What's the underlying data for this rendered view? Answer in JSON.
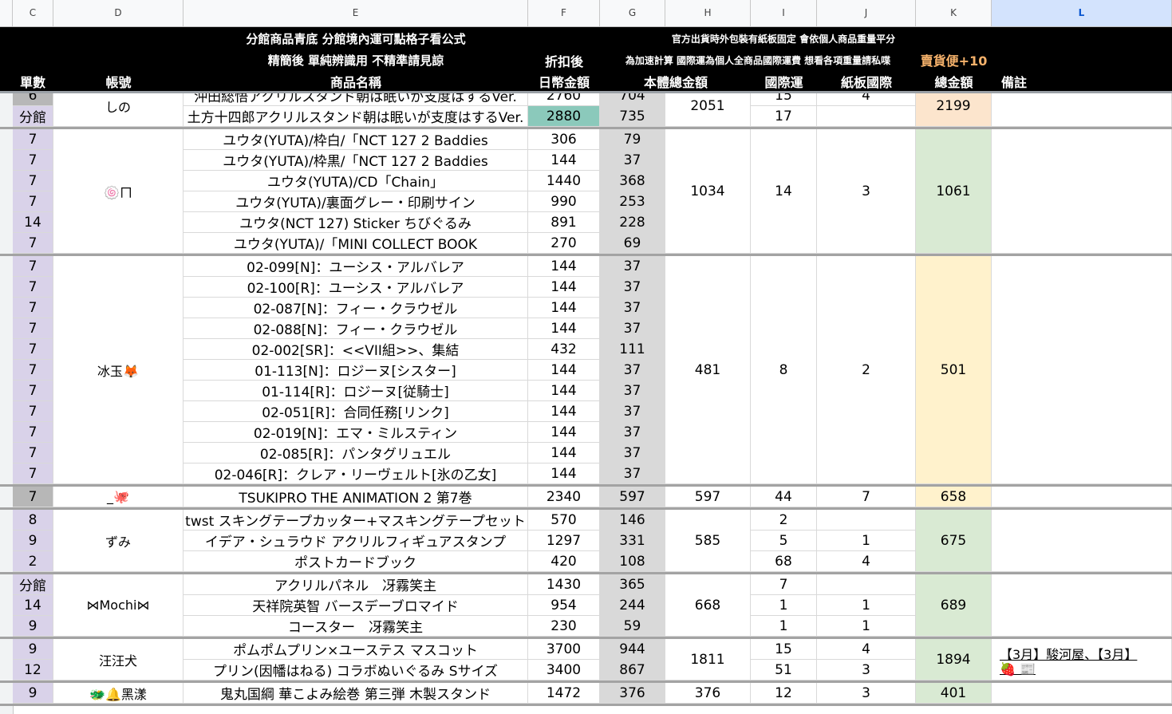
{
  "columns": [
    "C",
    "D",
    "E",
    "F",
    "G",
    "H",
    "I",
    "J",
    "K",
    "L"
  ],
  "selected_column": "L",
  "header": {
    "row1": {
      "E": "分館商品青底 分館境內運可點格子看公式",
      "H": "官方出貨時外包裝有紙板固定 會依個人商品重量平分"
    },
    "row2": {
      "E": "精簡後 單純辨識用 不精準請見諒",
      "F": "折扣後",
      "H": "為加速計算 國際運為個人全商品國際運費 想看各項重量請私喋",
      "K": "賣貨便+10"
    },
    "row3": {
      "C": "單數",
      "D": "帳號",
      "E": "商品名稱",
      "F": "日幣金額",
      "G": "本體總金額",
      "I": "國際運",
      "J": "紙板國際",
      "K": "總金額",
      "L": "備註"
    }
  },
  "colors": {
    "header_bg": "#000000",
    "accent_orange": "#f6b26b",
    "qty_bg": "#d9d2e9",
    "branch_highlight": "#8bc9bb"
  },
  "groups": [
    {
      "account": "しの",
      "H": "2051",
      "K": "2199",
      "k_color": "orange",
      "rows": [
        {
          "C": "6",
          "E": "沖田総悟アクリルスタンド朝は眠いが支度はするVer.",
          "F": "2760",
          "G": "704",
          "I": "15",
          "J": "4"
        },
        {
          "C": "分館",
          "E": "土方十四郎アクリルスタンド朝は眠いが支度はするVer.",
          "F": "2880",
          "G": "735",
          "I": "17",
          "J": "",
          "F_highlight": true
        }
      ]
    },
    {
      "account": "🍥ㄇ",
      "H": "1034",
      "K": "1061",
      "k_color": "green",
      "I": "14",
      "J": "3",
      "rows": [
        {
          "C": "7",
          "E": "ユウタ(YUTA)/枠白/「NCT 127 2 Baddies",
          "F": "306",
          "G": "79"
        },
        {
          "C": "7",
          "E": "ユウタ(YUTA)/枠黒/「NCT 127 2 Baddies",
          "F": "144",
          "G": "37"
        },
        {
          "C": "7",
          "E": "ユウタ(YUTA)/CD「Chain」",
          "F": "1440",
          "G": "368"
        },
        {
          "C": "7",
          "E": "ユウタ(YUTA)/裏面グレー・印刷サイン",
          "F": "990",
          "G": "253"
        },
        {
          "C": "14",
          "E": "ユウタ(NCT 127) Sticker ちびぐるみ",
          "F": "891",
          "G": "228"
        },
        {
          "C": "7",
          "E": "ユウタ(YUTA)/「MINI COLLECT BOOK",
          "F": "270",
          "G": "69"
        }
      ]
    },
    {
      "account": "冰玉🦊",
      "H": "481",
      "K": "501",
      "k_color": "yellow",
      "I": "8",
      "J": "2",
      "rows": [
        {
          "C": "7",
          "E": "02-099[N]：ユーシス・アルバレア",
          "F": "144",
          "G": "37"
        },
        {
          "C": "7",
          "E": "02-100[R]：ユーシス・アルバレア",
          "F": "144",
          "G": "37"
        },
        {
          "C": "7",
          "E": "02-087[N]：フィー・クラウゼル",
          "F": "144",
          "G": "37"
        },
        {
          "C": "7",
          "E": "02-088[N]：フィー・クラウゼル",
          "F": "144",
          "G": "37"
        },
        {
          "C": "7",
          "E": "02-002[SR]：<<VII組>>、集結",
          "F": "432",
          "G": "111"
        },
        {
          "C": "7",
          "E": "01-113[N]：ロジーヌ[シスター]",
          "F": "144",
          "G": "37"
        },
        {
          "C": "7",
          "E": "01-114[R]：ロジーヌ[従騎士]",
          "F": "144",
          "G": "37"
        },
        {
          "C": "7",
          "E": "02-051[R]：合同任務[リンク]",
          "F": "144",
          "G": "37"
        },
        {
          "C": "7",
          "E": "02-019[N]：エマ・ミルスティン",
          "F": "144",
          "G": "37"
        },
        {
          "C": "7",
          "E": "02-085[R]：パンタグリュエル",
          "F": "144",
          "G": "37"
        },
        {
          "C": "7",
          "E": "02-046[R]：クレア・リーヴェルト[氷の乙女]",
          "F": "144",
          "G": "37"
        }
      ]
    },
    {
      "account": "_🐙",
      "H": "597",
      "K": "658",
      "k_color": "yellow",
      "I": "44",
      "J": "7",
      "gray_qty": true,
      "rows": [
        {
          "C": "7",
          "E": "TSUKIPRO THE ANIMATION 2 第7巻",
          "F": "2340",
          "G": "597"
        }
      ]
    },
    {
      "account": "ずみ",
      "H": "585",
      "K": "675",
      "k_color": "green",
      "rows": [
        {
          "C": "8",
          "E": "twst スキングテープカッター+マスキングテープセット",
          "F": "570",
          "G": "146",
          "I": "2",
          "J": ""
        },
        {
          "C": "9",
          "E": "イデア・シュラウド アクリルフィギュアスタンプ",
          "F": "1297",
          "G": "331",
          "I": "5",
          "J": "1"
        },
        {
          "C": "2",
          "E": "ポストカードブック",
          "F": "420",
          "G": "108",
          "I": "68",
          "J": "4"
        }
      ]
    },
    {
      "account": "⋈Mochi⋈",
      "H": "668",
      "K": "689",
      "k_color": "green",
      "rows": [
        {
          "C": "分館",
          "E": "アクリルパネル　冴霧笑主",
          "F": "1430",
          "G": "365",
          "I": "7",
          "J": ""
        },
        {
          "C": "14",
          "E": "天祥院英智 バースデーブロマイド",
          "F": "954",
          "G": "244",
          "I": "1",
          "J": "1"
        },
        {
          "C": "9",
          "E": "コースター　冴霧笑主",
          "F": "230",
          "G": "59",
          "I": "1",
          "J": "1"
        }
      ]
    },
    {
      "account": "汪汪犬",
      "H": "1811",
      "K": "1894",
      "k_color": "green",
      "note_line1": "【3月】駿河屋、【3月】",
      "note_line2": "🍓 📰",
      "rows": [
        {
          "C": "9",
          "E": "ポムポムプリン×ユーステス マスコット",
          "F": "3700",
          "G": "944",
          "I": "15",
          "J": "4"
        },
        {
          "C": "12",
          "E": "プリン(因幡はねる) コラボぬいぐるみ Sサイズ",
          "F": "3400",
          "G": "867",
          "I": "51",
          "J": "3"
        }
      ]
    },
    {
      "account": "🐲🔔黑漾",
      "H": "376",
      "K": "401",
      "k_color": "green",
      "I": "12",
      "J": "3",
      "rows": [
        {
          "C": "9",
          "E": "鬼丸国綱 華こよみ絵巻 第三弾 木製スタンド",
          "F": "1472",
          "G": "376"
        }
      ]
    }
  ]
}
